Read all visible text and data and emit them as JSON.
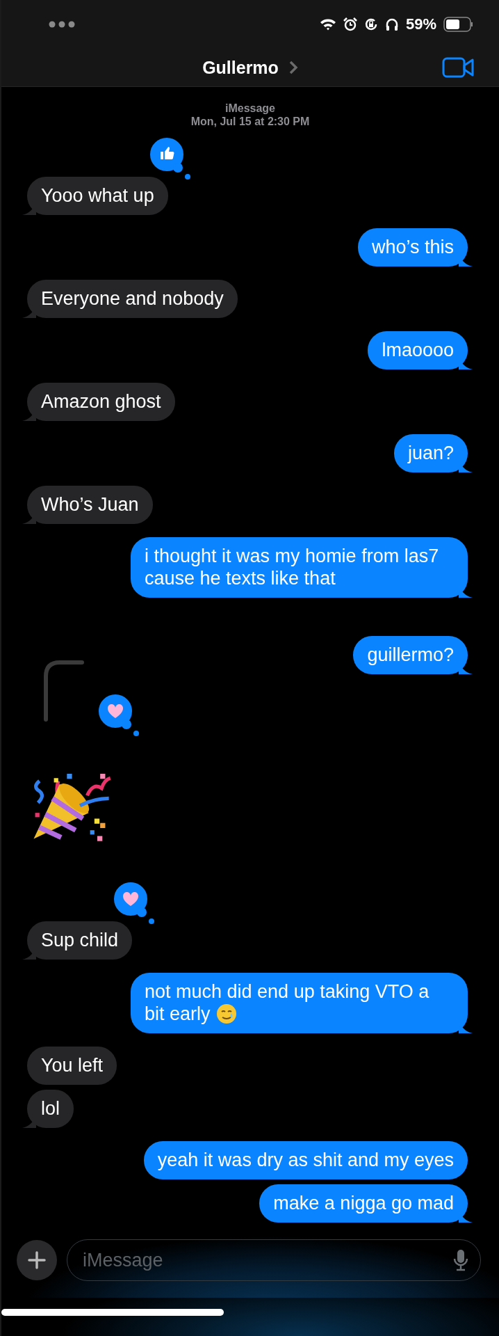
{
  "status_bar": {
    "battery_text": "59%"
  },
  "header": {
    "title": "Gullermo"
  },
  "thread_info": {
    "service": "iMessage",
    "timestamp": "Mon, Jul 15 at 2:30 PM"
  },
  "messages": [
    {
      "kind": "text",
      "outgoing": false,
      "text": "Yooo what up",
      "reaction": {
        "kind": "like"
      }
    },
    {
      "kind": "text",
      "outgoing": true,
      "text": "who’s this"
    },
    {
      "kind": "text",
      "outgoing": false,
      "text": "Everyone and nobody"
    },
    {
      "kind": "text",
      "outgoing": true,
      "text": "lmaoooo"
    },
    {
      "kind": "text",
      "outgoing": false,
      "text": "Amazon ghost"
    },
    {
      "kind": "text",
      "outgoing": true,
      "text": "juan?"
    },
    {
      "kind": "text",
      "outgoing": false,
      "text": "Who’s Juan"
    },
    {
      "kind": "text",
      "outgoing": true,
      "text": "i thought it was my homie from las7 cause he texts like that"
    },
    {
      "kind": "text",
      "outgoing": true,
      "text": "guillermo?"
    },
    {
      "kind": "sticker",
      "outgoing": false,
      "reaction": {
        "kind": "love"
      }
    },
    {
      "kind": "text",
      "outgoing": false,
      "text": "Sup child",
      "reaction": {
        "kind": "love"
      }
    },
    {
      "kind": "text",
      "outgoing": true,
      "text": "not much did end up taking VTO a bit early",
      "emoji": {
        "kind": "smile-tear"
      }
    },
    {
      "kind": "text",
      "outgoing": false,
      "text": "You left"
    },
    {
      "kind": "text",
      "outgoing": false,
      "text": "lol"
    },
    {
      "kind": "text",
      "outgoing": true,
      "text": "yeah it was dry as shit and my eyes"
    },
    {
      "kind": "text",
      "outgoing": true,
      "text": "make a nigga go mad"
    }
  ],
  "composer": {
    "placeholder": "iMessage"
  }
}
